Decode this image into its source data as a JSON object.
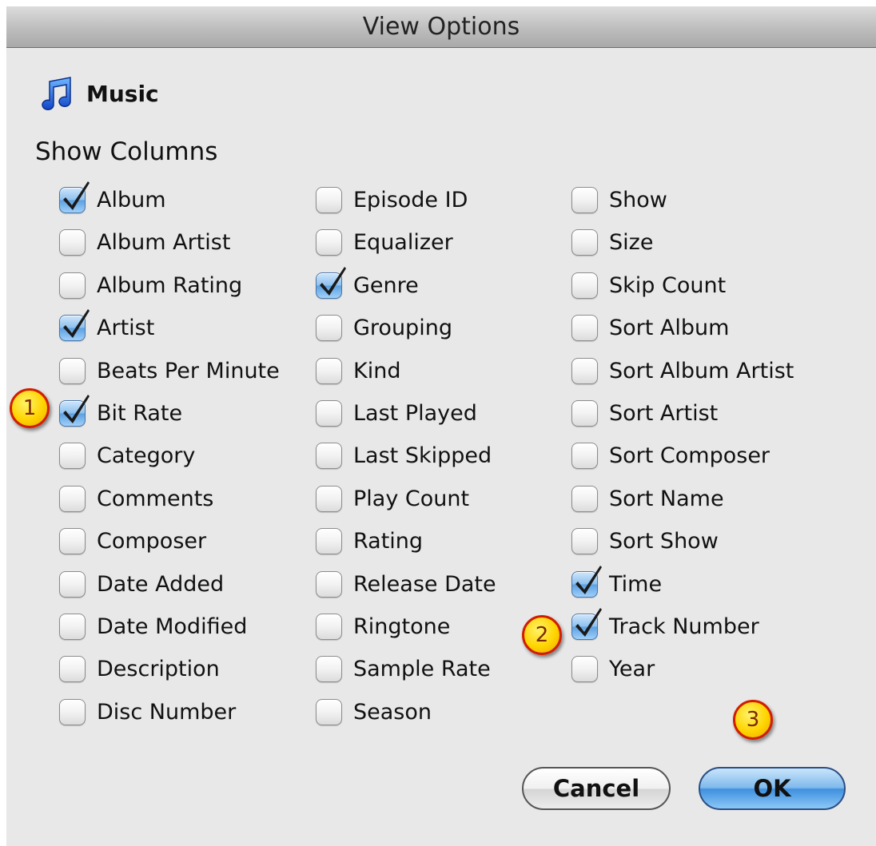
{
  "window": {
    "title": "View Options"
  },
  "source": {
    "icon": "music-note-icon",
    "label": "Music"
  },
  "section": {
    "title": "Show Columns"
  },
  "columns": [
    [
      {
        "label": "Album",
        "checked": true
      },
      {
        "label": "Album Artist",
        "checked": false
      },
      {
        "label": "Album Rating",
        "checked": false
      },
      {
        "label": "Artist",
        "checked": true
      },
      {
        "label": "Beats Per Minute",
        "checked": false
      },
      {
        "label": "Bit Rate",
        "checked": true
      },
      {
        "label": "Category",
        "checked": false
      },
      {
        "label": "Comments",
        "checked": false
      },
      {
        "label": "Composer",
        "checked": false
      },
      {
        "label": "Date Added",
        "checked": false
      },
      {
        "label": "Date Modified",
        "checked": false
      },
      {
        "label": "Description",
        "checked": false
      },
      {
        "label": "Disc Number",
        "checked": false
      }
    ],
    [
      {
        "label": "Episode ID",
        "checked": false
      },
      {
        "label": "Equalizer",
        "checked": false
      },
      {
        "label": "Genre",
        "checked": true
      },
      {
        "label": "Grouping",
        "checked": false
      },
      {
        "label": "Kind",
        "checked": false
      },
      {
        "label": "Last Played",
        "checked": false
      },
      {
        "label": "Last Skipped",
        "checked": false
      },
      {
        "label": "Play Count",
        "checked": false
      },
      {
        "label": "Rating",
        "checked": false
      },
      {
        "label": "Release Date",
        "checked": false
      },
      {
        "label": "Ringtone",
        "checked": false
      },
      {
        "label": "Sample Rate",
        "checked": false
      },
      {
        "label": "Season",
        "checked": false
      }
    ],
    [
      {
        "label": "Show",
        "checked": false
      },
      {
        "label": "Size",
        "checked": false
      },
      {
        "label": "Skip Count",
        "checked": false
      },
      {
        "label": "Sort Album",
        "checked": false
      },
      {
        "label": "Sort Album Artist",
        "checked": false
      },
      {
        "label": "Sort Artist",
        "checked": false
      },
      {
        "label": "Sort Composer",
        "checked": false
      },
      {
        "label": "Sort Name",
        "checked": false
      },
      {
        "label": "Sort Show",
        "checked": false
      },
      {
        "label": "Time",
        "checked": true
      },
      {
        "label": "Track Number",
        "checked": true
      },
      {
        "label": "Year",
        "checked": false
      }
    ]
  ],
  "callouts": [
    "1",
    "2",
    "3"
  ],
  "buttons": {
    "cancel": "Cancel",
    "ok": "OK"
  },
  "colors": {
    "checked_fill": "#5da0e0",
    "callout_fill": "#ffd400",
    "callout_border": "#d11d00",
    "default_button": "#3f90de"
  }
}
